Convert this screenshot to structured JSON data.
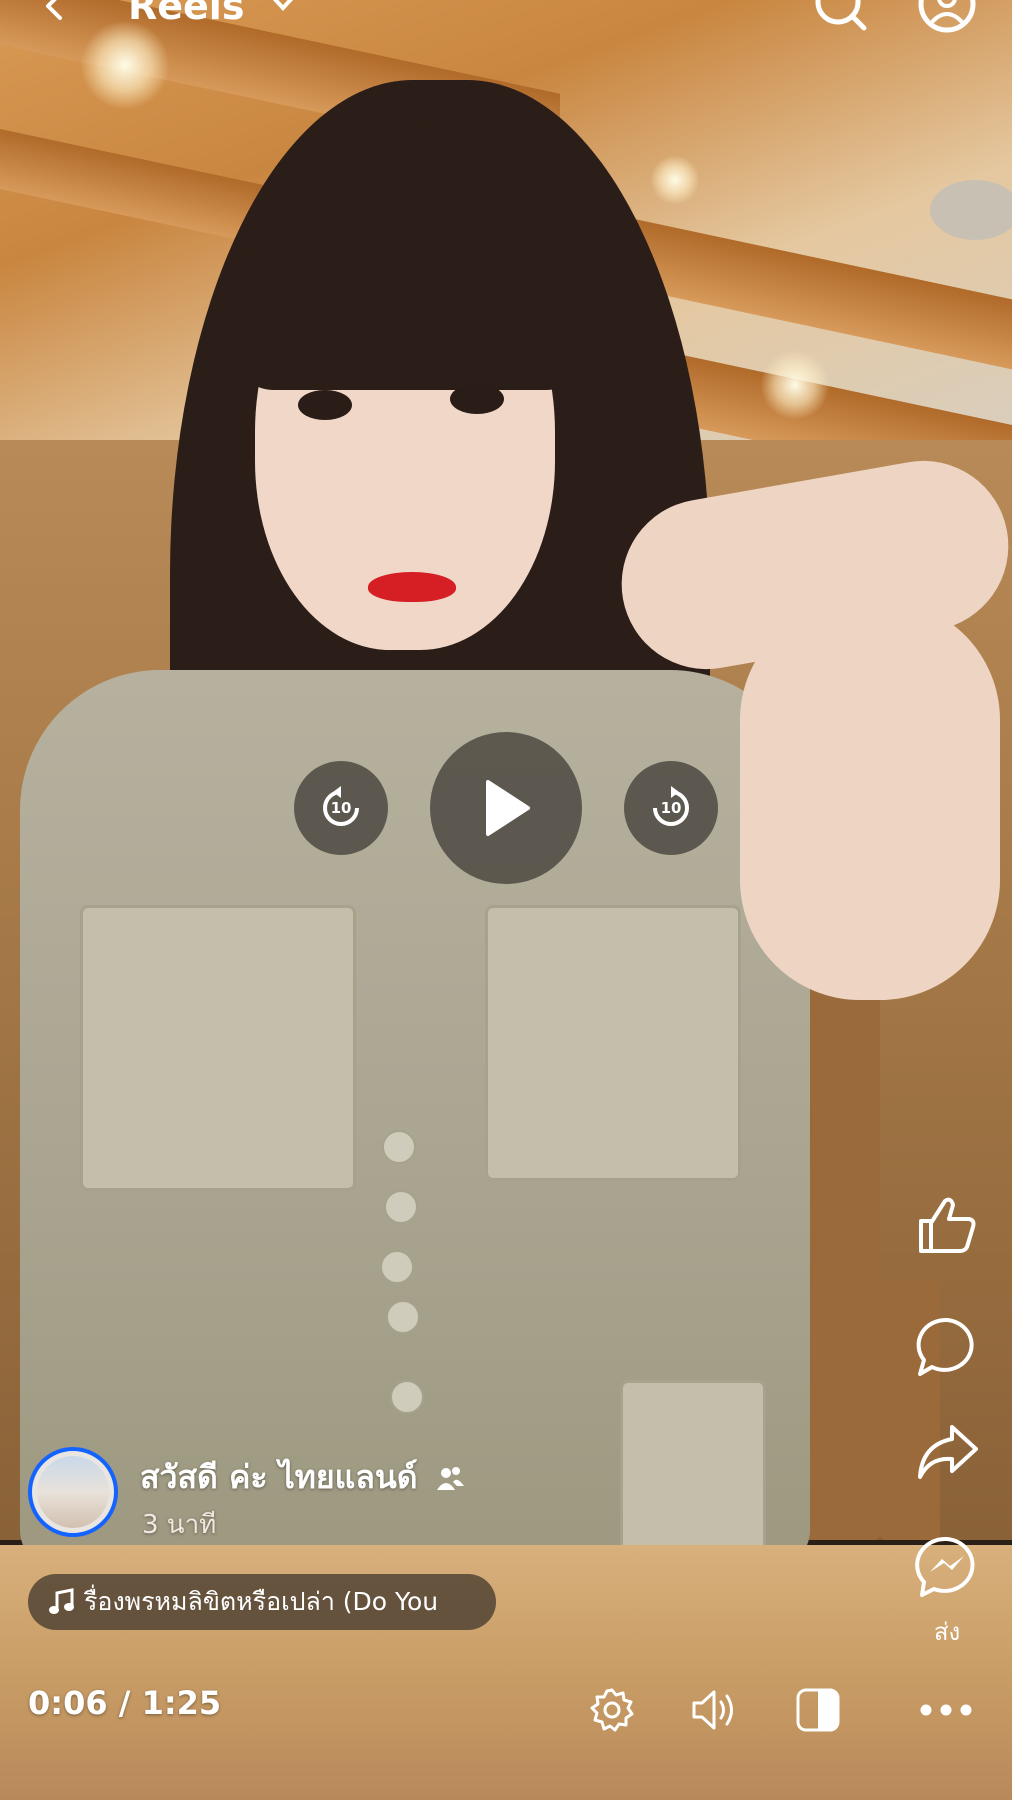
{
  "header": {
    "title": "Reels",
    "icons": [
      "back-arrow-icon",
      "chevron-down-icon",
      "search-icon",
      "profile-icon"
    ]
  },
  "player": {
    "rewind_seconds": "10",
    "forward_seconds": "10",
    "state": "paused"
  },
  "actions": {
    "like": "thumbs-up-icon",
    "comment": "comment-icon",
    "share": "share-icon",
    "messenger": "messenger-icon",
    "messenger_label": "ส่ง"
  },
  "post": {
    "author": "สวัสดี ค่ะ ไทยแลนด์",
    "time_ago": "3 นาที",
    "audience_icon": "friends-icon"
  },
  "music": {
    "title": "รื่องพรหมลิขิตหรือเปล่า (Do You"
  },
  "playback": {
    "timecode": "0:06 / 1:25",
    "bottom_icons": [
      "settings-icon",
      "volume-icon",
      "caption-toggle-icon",
      "more-icon"
    ]
  },
  "colors": {
    "avatar_ring": "#1463ff",
    "control_bg": "#3c3732"
  }
}
